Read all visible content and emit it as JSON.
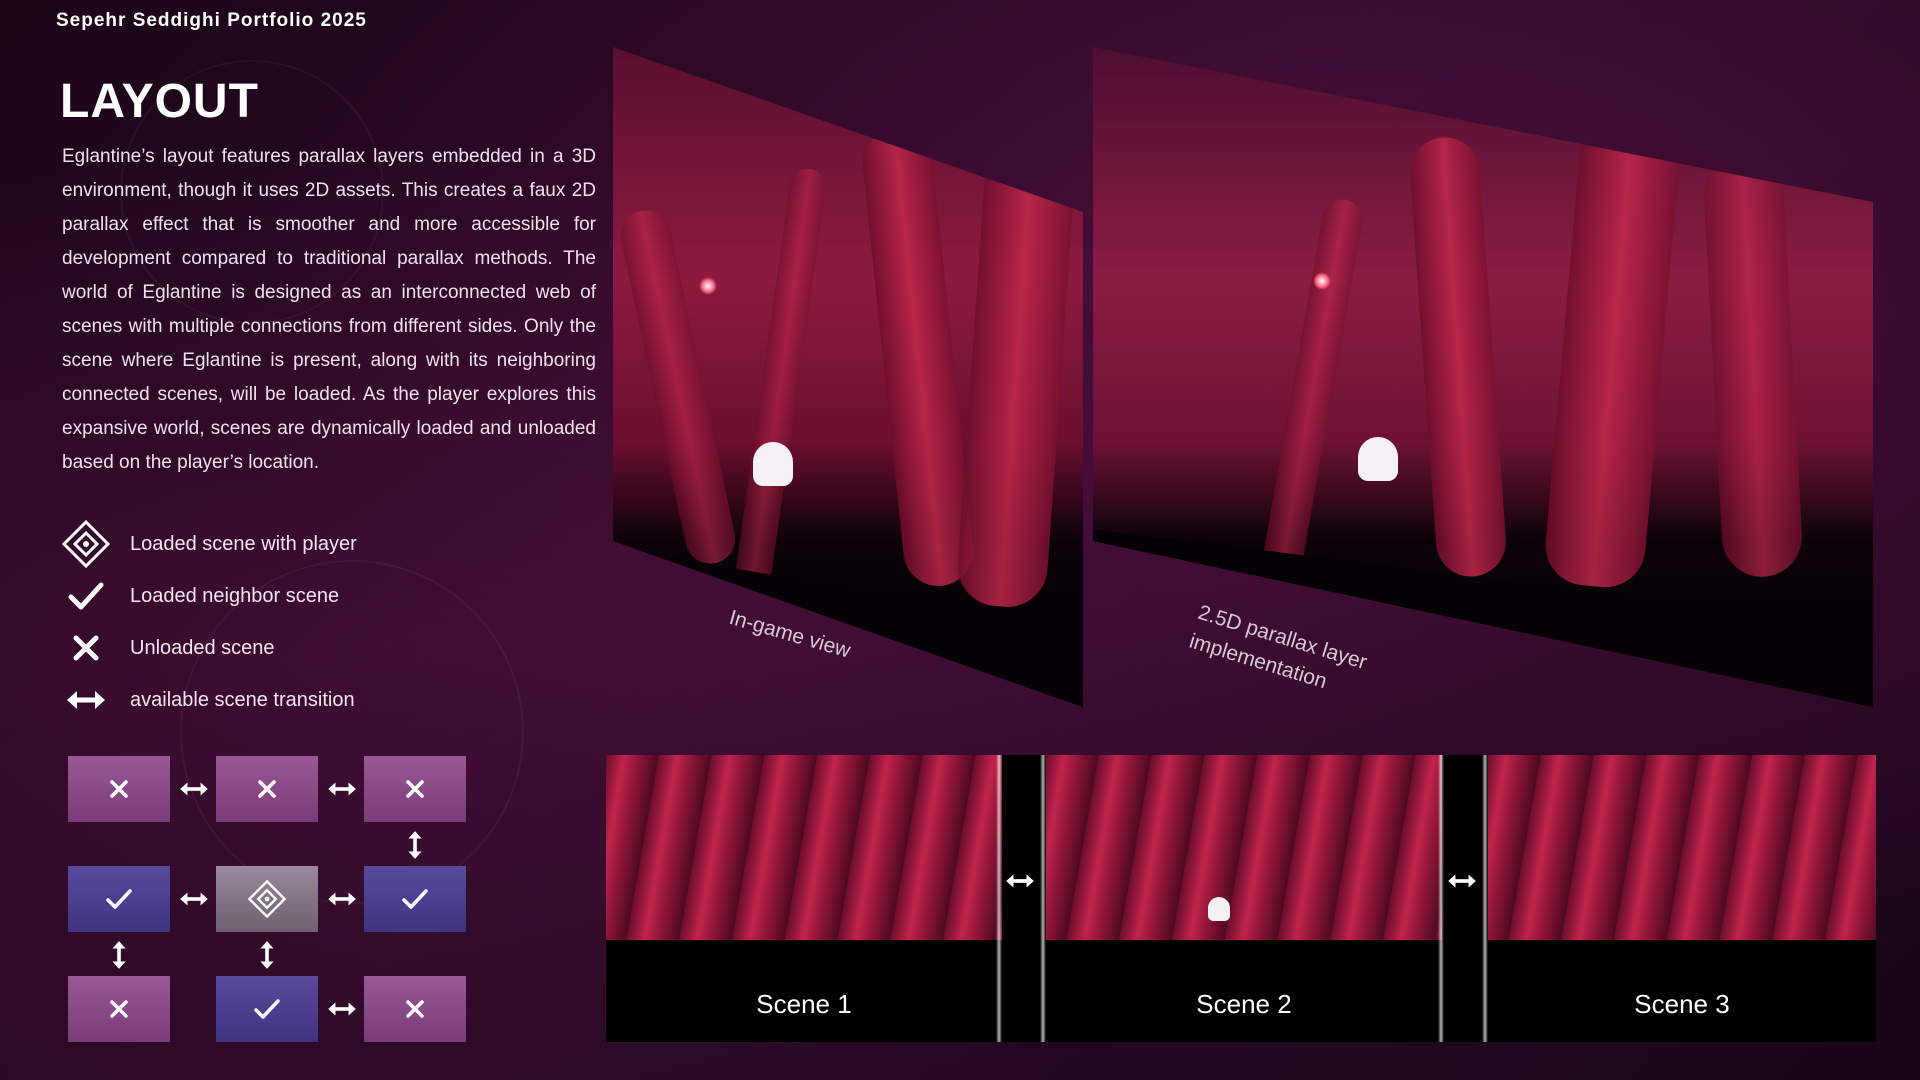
{
  "header": {
    "portfolio": "Sepehr Seddighi Portfolio 2025"
  },
  "section": {
    "title": "LAYOUT",
    "description": "Eglantine’s layout features parallax layers embedded in a 3D environment, though it uses 2D assets. This creates a faux 2D parallax effect that is smoother and more accessible for development compared to traditional parallax methods. The world of Eglantine is designed as an interconnected web of scenes with multiple connections from different sides. Only the scene where Eglantine is present, along with its neighboring connected scenes, will be loaded. As the player explores this expansive world, scenes are dynamically loaded and unloaded based on the player’s location."
  },
  "legend": [
    {
      "icon": "diamond-icon",
      "label": "Loaded scene with player"
    },
    {
      "icon": "check-icon",
      "label": "Loaded neighbor scene"
    },
    {
      "icon": "x-icon",
      "label": "Unloaded scene"
    },
    {
      "icon": "double-arrow-icon",
      "label": "available scene transition"
    }
  ],
  "grid": [
    [
      "unloaded",
      "unloaded",
      "unloaded"
    ],
    [
      "neighbor",
      "player",
      "neighbor"
    ],
    [
      "unloaded",
      "neighbor",
      "unloaded"
    ]
  ],
  "panels": {
    "ingame_label": "In-game view",
    "parallax_label": "2.5D parallax layer implementation"
  },
  "scenes": [
    "Scene 1",
    "Scene 2",
    "Scene 3"
  ],
  "colors": {
    "unloaded": "#8a4a86",
    "neighbor": "#4b3f8f",
    "player": "#847684",
    "background": "#1a0616"
  }
}
